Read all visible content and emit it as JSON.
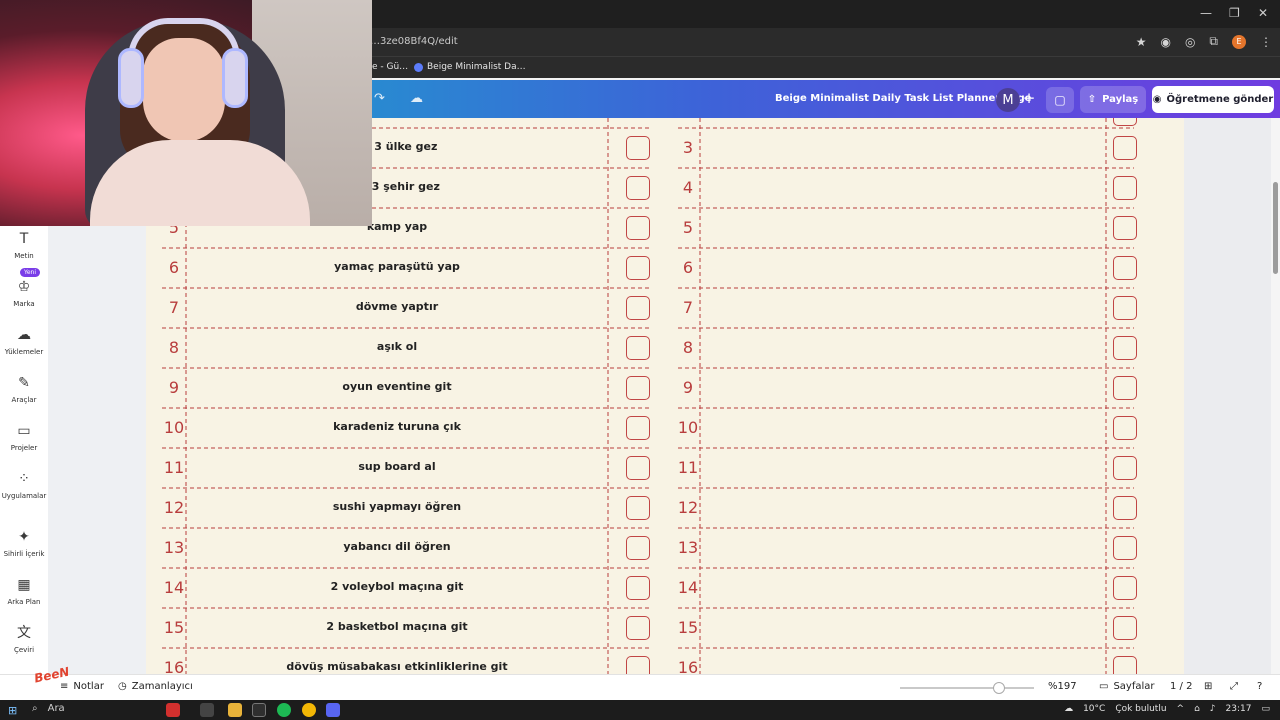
{
  "browser": {
    "url": "…3ze08Bf4Q/edit",
    "bookmarks": [
      "e - Gü…",
      "Beige Minimalist Da…"
    ],
    "profile_initial": "E",
    "window_controls": [
      "—",
      "❐",
      "✕"
    ]
  },
  "canva_header": {
    "doc_title": "Beige Minimalist Daily Task List Planner Page",
    "avatar_initial": "M",
    "share_label": "Paylaş",
    "teacher_label": "Öğretmene gönder"
  },
  "sidebar": {
    "new_badge": "Yeni",
    "items": [
      {
        "label": "Metin",
        "icon": "T"
      },
      {
        "label": "Marka",
        "icon": "♔"
      },
      {
        "label": "Yüklemeler",
        "icon": "☁"
      },
      {
        "label": "Araçlar",
        "icon": "✎"
      },
      {
        "label": "Projeler",
        "icon": "▭"
      },
      {
        "label": "Uygulamalar",
        "icon": "⁘"
      },
      {
        "label": "Sihirli İçerik",
        "icon": "✦"
      },
      {
        "label": "Arka Plan",
        "icon": "▦"
      },
      {
        "label": "Çeviri",
        "icon": "文"
      }
    ]
  },
  "planner": {
    "left_rows": [
      {
        "num": "",
        "task": "az 3 ülke gez"
      },
      {
        "num": "",
        "task": "az 3 şehir gez"
      },
      {
        "num": "5",
        "task": "kamp yap"
      },
      {
        "num": "6",
        "task": "yamaç paraşütü yap"
      },
      {
        "num": "7",
        "task": "dövme yaptır"
      },
      {
        "num": "8",
        "task": "aşık ol"
      },
      {
        "num": "9",
        "task": "oyun eventine git"
      },
      {
        "num": "10",
        "task": "karadeniz turuna çık"
      },
      {
        "num": "11",
        "task": "sup board al"
      },
      {
        "num": "12",
        "task": "sushi yapmayı öğren"
      },
      {
        "num": "13",
        "task": "yabancı dil öğren"
      },
      {
        "num": "14",
        "task": "2 voleybol maçına git"
      },
      {
        "num": "15",
        "task": "2 basketbol maçına git"
      },
      {
        "num": "16",
        "task": "dövüş müsabakası etkinliklerine git"
      }
    ],
    "right_nums": [
      "3",
      "4",
      "5",
      "6",
      "7",
      "8",
      "9",
      "10",
      "11",
      "12",
      "13",
      "14",
      "15",
      "16"
    ]
  },
  "bottom_bar": {
    "notes_label": "Notlar",
    "timer_label": "Zamanlayıcı",
    "zoom": "%197",
    "pages_label": "Sayfalar",
    "page_indicator": "1 / 2"
  },
  "taskbar": {
    "search_label": "Ara",
    "weather": "10°C",
    "weather_desc": "Çok bulutlu",
    "time": "23:17"
  },
  "colors": {
    "accent_red": "#b83d3d",
    "page_bg": "#f8f3e4",
    "gradient_start": "#12b5c9",
    "gradient_end": "#6f3ce0"
  }
}
